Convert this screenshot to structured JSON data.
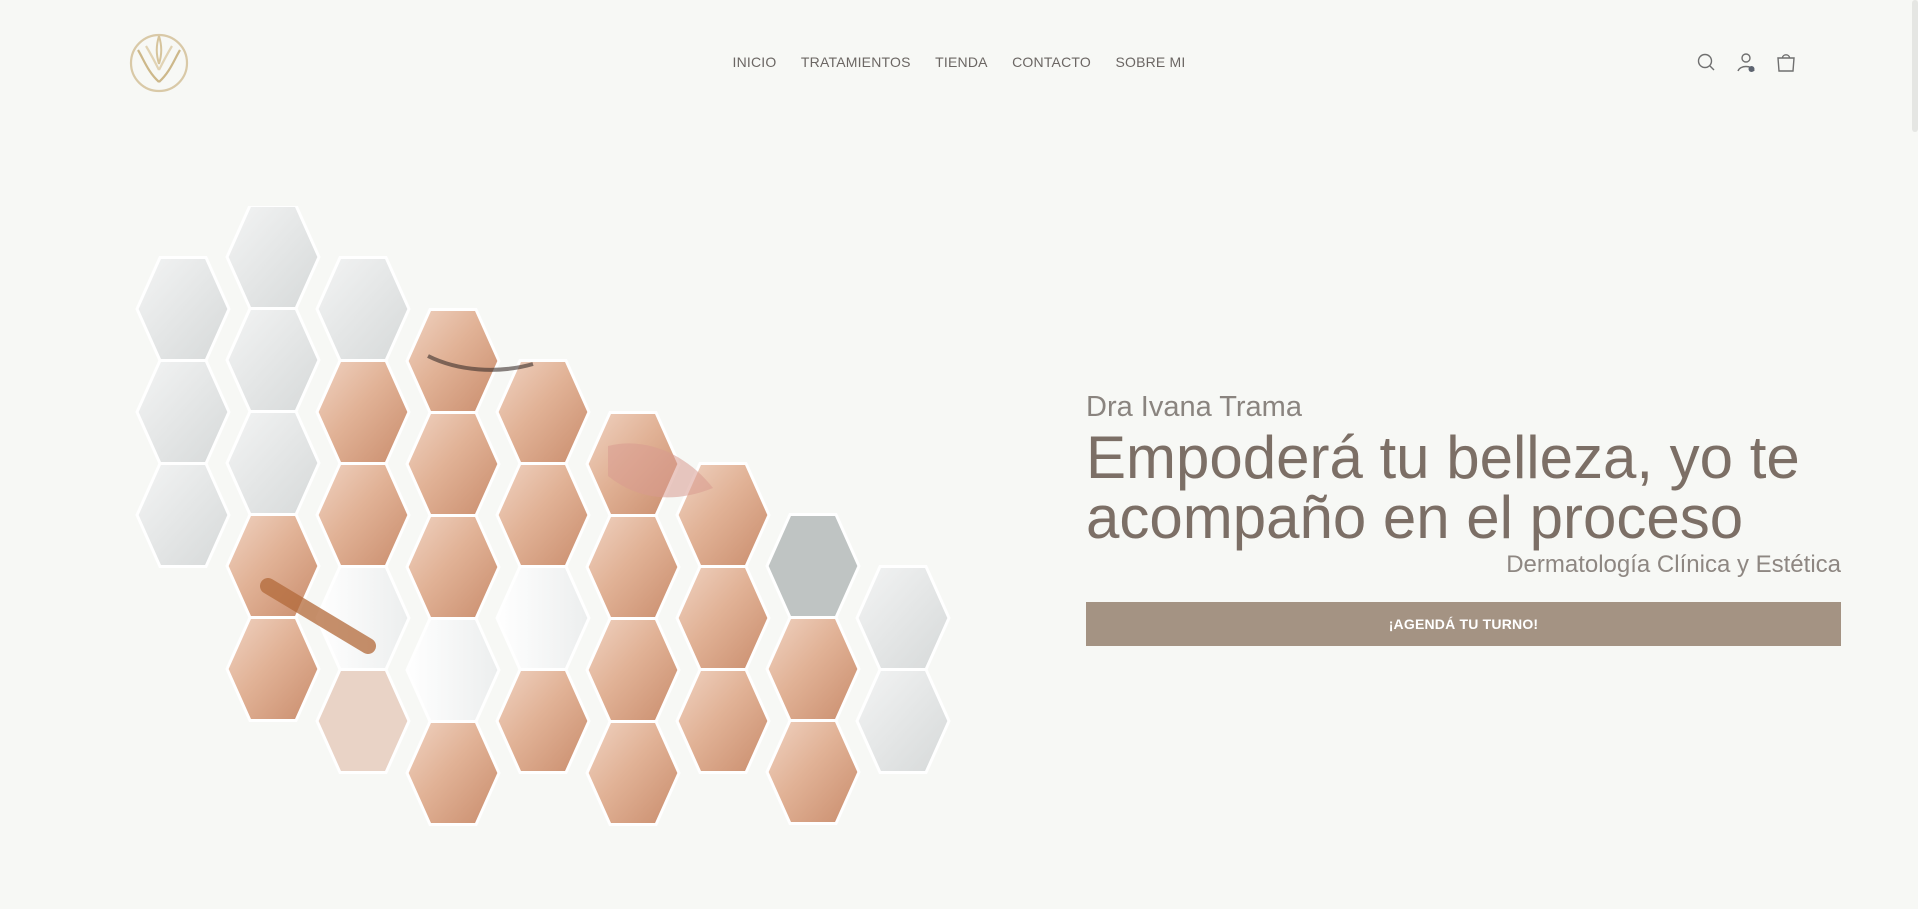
{
  "brand": {
    "logo_name": "Dra Ivana Trama monogram"
  },
  "nav": {
    "items": [
      {
        "label": "INICIO"
      },
      {
        "label": "TRATAMIENTOS"
      },
      {
        "label": "TIENDA"
      },
      {
        "label": "CONTACTO"
      },
      {
        "label": "SOBRE MI"
      }
    ]
  },
  "header_icons": {
    "search": "search-icon",
    "account": "user-icon",
    "cart": "shopping-bag-icon"
  },
  "hero": {
    "name": "Dra Ivana Trama",
    "headline": "Empoderá tu belleza, yo te acompaño en el proceso",
    "subtitle": "Dermatología Clínica y Estética",
    "cta_label": "¡AGENDÁ TU TURNO!"
  },
  "colors": {
    "background": "#f7f8f5",
    "accent": "#a49383",
    "text_primary": "#7c6f66",
    "text_secondary": "#8a847f",
    "logo_gold": "#d9c9a7"
  }
}
